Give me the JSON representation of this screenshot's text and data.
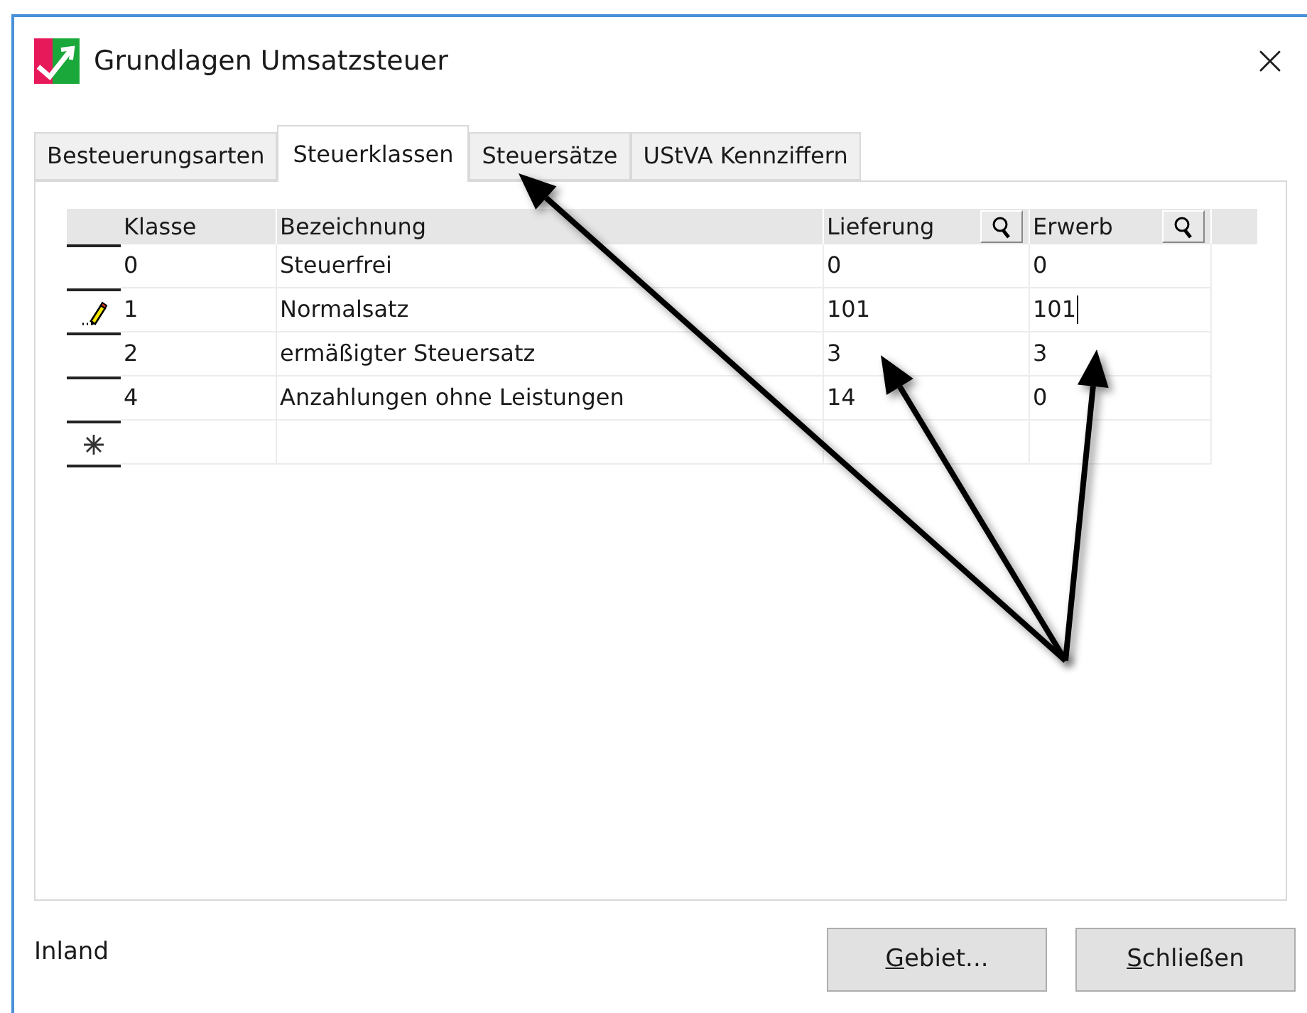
{
  "window": {
    "title": "Grundlagen Umsatzsteuer"
  },
  "tabs": [
    {
      "label": "Besteuerungsarten",
      "selected": false
    },
    {
      "label": "Steuerklassen",
      "selected": true
    },
    {
      "label": "Steuersätze",
      "selected": false
    },
    {
      "label": "UStVA Kennziffern",
      "selected": false
    }
  ],
  "table": {
    "columns": [
      {
        "label": "Klasse",
        "lookup": false
      },
      {
        "label": "Bezeichnung",
        "lookup": false
      },
      {
        "label": "Lieferung",
        "lookup": true
      },
      {
        "label": "Erwerb",
        "lookup": true
      }
    ],
    "rows": [
      {
        "kind": "record",
        "editing": false,
        "cells": [
          "0",
          "Steuerfrei",
          "0",
          "0"
        ]
      },
      {
        "kind": "record",
        "editing": true,
        "cells": [
          "1",
          "Normalsatz",
          "101",
          "101"
        ]
      },
      {
        "kind": "record",
        "editing": false,
        "cells": [
          "2",
          "ermäßigter Steuersatz",
          "3",
          "3"
        ]
      },
      {
        "kind": "record",
        "editing": false,
        "cells": [
          "4",
          "Anzahlungen ohne Leistungen",
          "14",
          "0"
        ]
      },
      {
        "kind": "new"
      }
    ]
  },
  "status": "Inland",
  "buttons": [
    {
      "label": "Gebiet..."
    },
    {
      "label": "Schließen"
    }
  ]
}
